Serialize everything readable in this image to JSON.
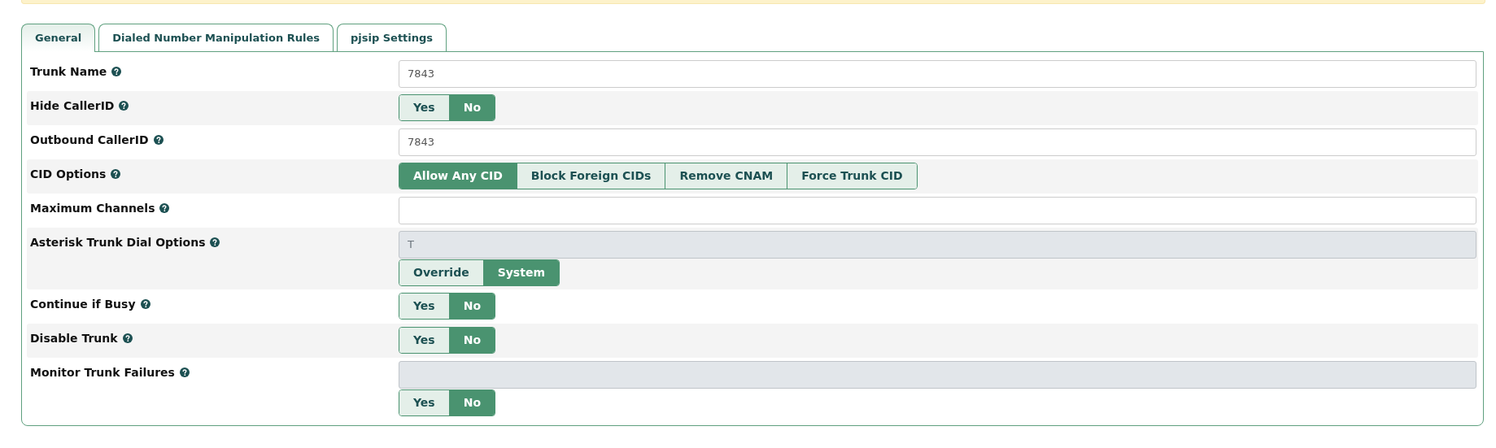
{
  "tabs": [
    {
      "label": "General",
      "selected": true
    },
    {
      "label": "Dialed Number Manipulation Rules",
      "selected": false
    },
    {
      "label": "pjsip Settings",
      "selected": false
    }
  ],
  "rows": [
    {
      "label": "Trunk Name",
      "input": {
        "value": "7843",
        "disabled": false
      }
    },
    {
      "label": "Hide CallerID",
      "options": [
        {
          "label": "Yes",
          "selected": false
        },
        {
          "label": "No",
          "selected": true
        }
      ]
    },
    {
      "label": "Outbound CallerID",
      "input": {
        "value": "7843",
        "disabled": false
      }
    },
    {
      "label": "CID Options",
      "options": [
        {
          "label": "Allow Any CID",
          "selected": true
        },
        {
          "label": "Block Foreign CIDs",
          "selected": false
        },
        {
          "label": "Remove CNAM",
          "selected": false
        },
        {
          "label": "Force Trunk CID",
          "selected": false
        }
      ]
    },
    {
      "label": "Maximum Channels",
      "input": {
        "disabled": false
      }
    },
    {
      "label": "Asterisk Trunk Dial Options",
      "input": {
        "value": "T",
        "disabled": true
      },
      "options": [
        {
          "label": "Override",
          "selected": false
        },
        {
          "label": "System",
          "selected": true
        }
      ]
    },
    {
      "label": "Continue if Busy",
      "options": [
        {
          "label": "Yes",
          "selected": false
        },
        {
          "label": "No",
          "selected": true
        }
      ]
    },
    {
      "label": "Disable Trunk",
      "options": [
        {
          "label": "Yes",
          "selected": false
        },
        {
          "label": "No",
          "selected": true
        }
      ]
    },
    {
      "label": "Monitor Trunk Failures",
      "input": {
        "disabled": true
      },
      "options": [
        {
          "label": "Yes",
          "selected": false
        },
        {
          "label": "No",
          "selected": true
        }
      ]
    }
  ]
}
